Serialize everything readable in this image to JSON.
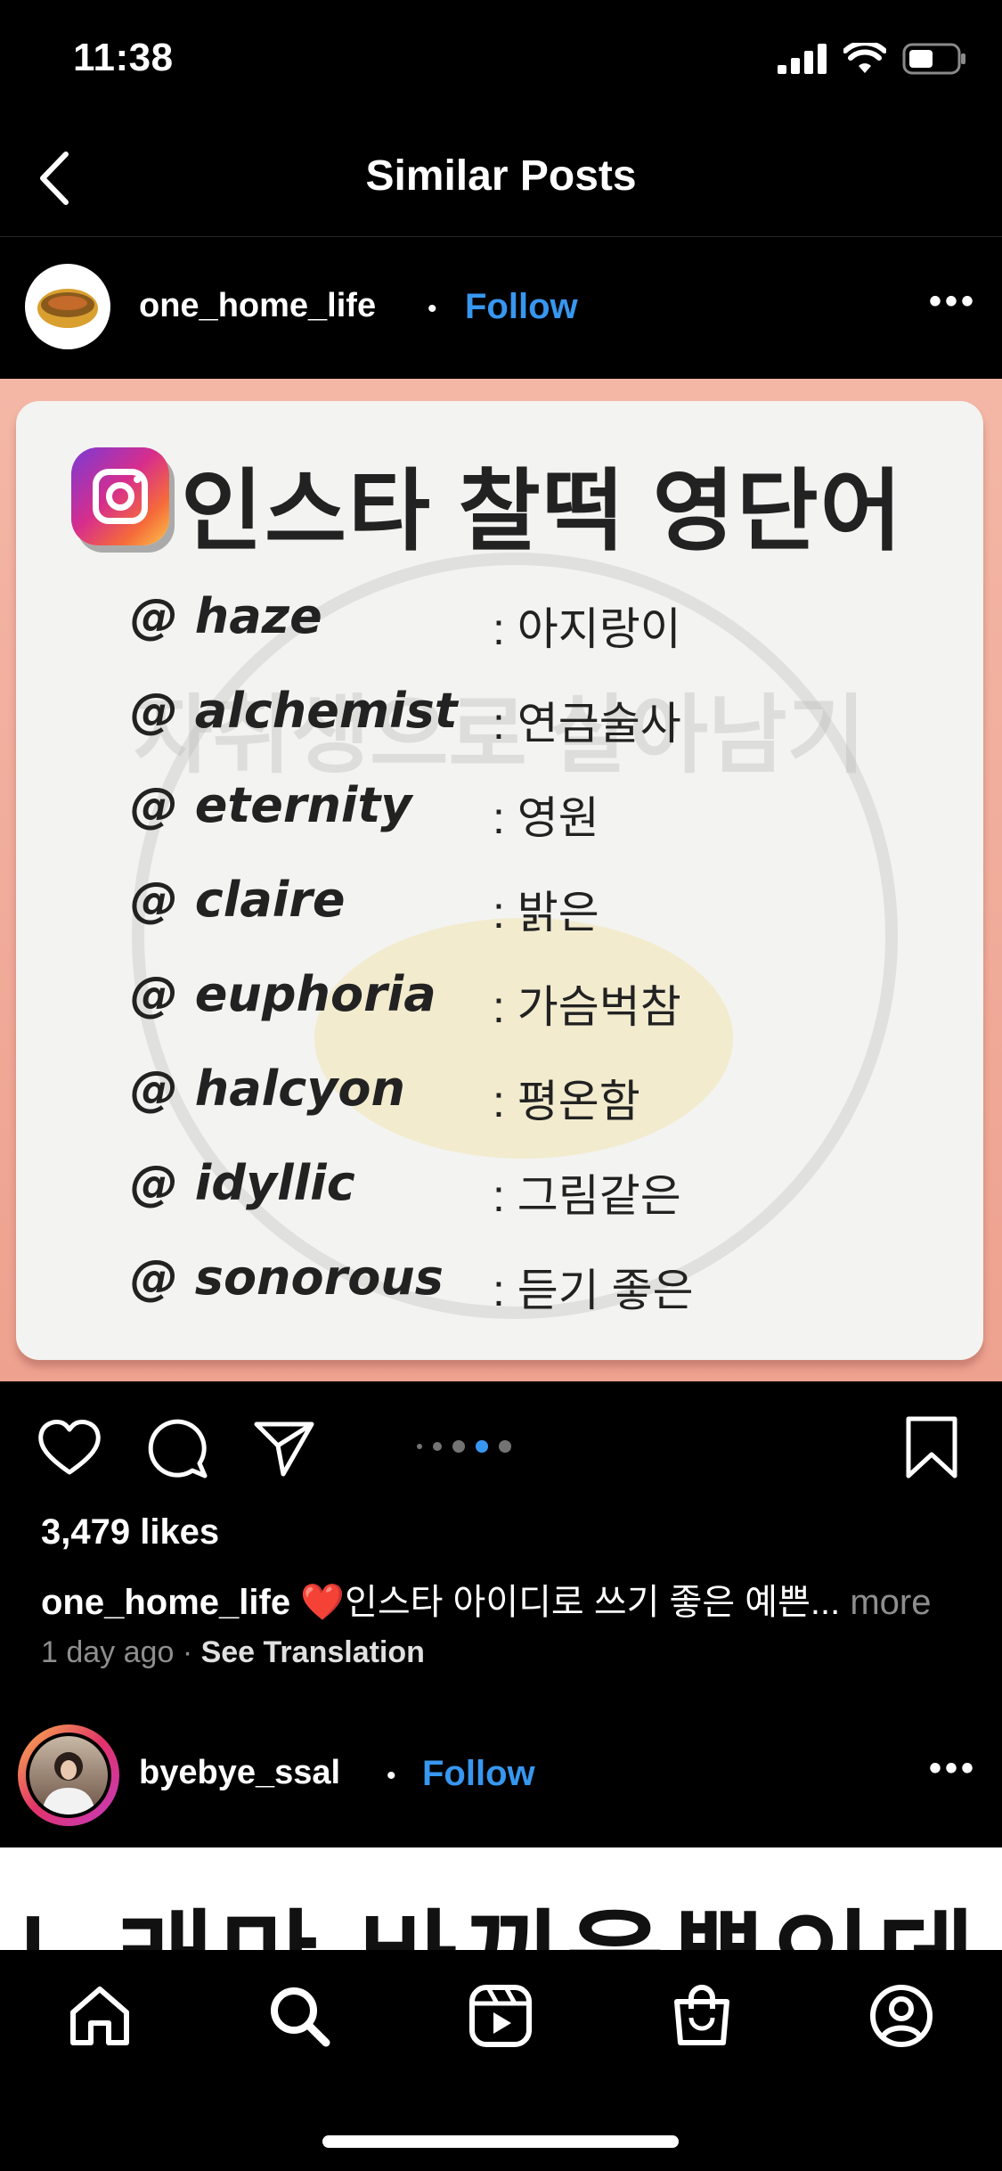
{
  "status_bar": {
    "time": "11:38"
  },
  "header": {
    "title": "Similar Posts"
  },
  "post1": {
    "username": "one_home_life",
    "separator": "•",
    "follow_label": "Follow",
    "image": {
      "title": "인스타 찰떡 영단어",
      "watermark": "자취생으로 살아남기",
      "entries": [
        {
          "word": "@ haze",
          "meaning": ": 아지랑이"
        },
        {
          "word": "@ alchemist",
          "meaning": ": 연금술사"
        },
        {
          "word": "@ eternity",
          "meaning": ": 영원"
        },
        {
          "word": "@ claire",
          "meaning": ": 밝은"
        },
        {
          "word": "@ euphoria",
          "meaning": ": 가슴벅참"
        },
        {
          "word": "@ halcyon",
          "meaning": ": 평온함"
        },
        {
          "word": "@ idyllic",
          "meaning": ": 그림같은"
        },
        {
          "word": "@ sonorous",
          "meaning": ": 듣기 좋은"
        }
      ]
    },
    "pager": {
      "total": 5,
      "active": 4
    },
    "likes": "3,479 likes",
    "caption_user": "one_home_life",
    "caption_heart": "❤️",
    "caption_text": "인스타 아이디로 쓰기 좋은 예쁜...",
    "caption_more": "more",
    "time_ago": "1 day ago",
    "meta_separator": "·",
    "see_translation": "See Translation"
  },
  "post2": {
    "username": "byebye_ssal",
    "separator": "•",
    "follow_label": "Follow",
    "image_text": "노래만 바뀌을뿐인데"
  },
  "tab_bar": {
    "items": [
      "home-icon",
      "search-icon",
      "reels-icon",
      "shop-icon",
      "profile-icon"
    ]
  },
  "colors": {
    "accent": "#3797f0",
    "background": "#000000",
    "muted": "#8e8e8e"
  }
}
